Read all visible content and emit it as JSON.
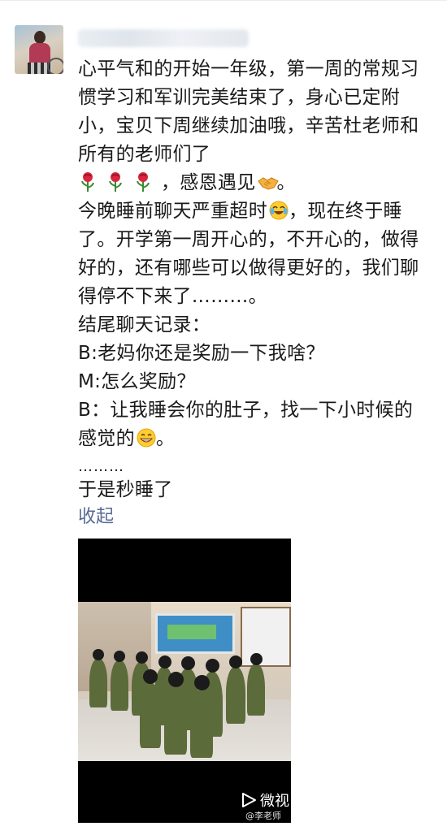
{
  "post": {
    "author_avatar": "avatar-photo",
    "paragraphs": [
      "心平气和的开始一年级，第一周的常规习惯学习和军训完美结束了，身心已定附小，宝贝下周继续加油哦，辛苦杜老师和所有的老师们了",
      "，感恩遇见",
      "。",
      "今晚睡前聊天严重超时",
      "，现在终于睡了。开学第一周开心的，不开心的，做得好的，还有哪些可以做得更好的，我们聊得停不下来了………。",
      "结尾聊天记录：",
      "B:老妈你还是奖励一下我啥？",
      "M:怎么奖励？",
      "B：让我睡会你的肚子，找一下小时候的感觉的",
      "。",
      "………",
      "于是秒睡了"
    ],
    "collapse_label": "收起",
    "emojis": {
      "roses": "rose-emoji",
      "handshake": "handshake-emoji",
      "laugh_cry": "laughing-crying-emoji",
      "grin": "grinning-emoji"
    }
  },
  "video": {
    "platform_label": "微视",
    "username": "@李老师"
  },
  "colors": {
    "link": "#576b95",
    "text": "#1a1a1a",
    "video_bg": "#000000"
  }
}
